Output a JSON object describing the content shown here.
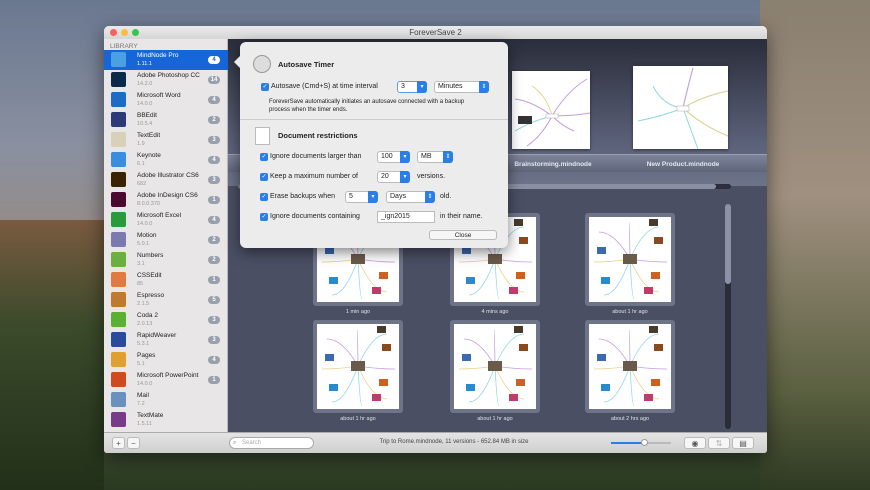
{
  "window": {
    "title": "ForeverSave 2"
  },
  "sidebar": {
    "header": "LIBRARY",
    "items": [
      {
        "name": "MindNode Pro",
        "version": "1.11.1",
        "count": "4",
        "selected": true,
        "icon": "mindnode-icon",
        "color": "#4aa0e0"
      },
      {
        "name": "Adobe Photoshop CC",
        "version": "14.2.0",
        "count": "14",
        "icon": "photoshop-icon",
        "color": "#0b2a4a"
      },
      {
        "name": "Microsoft Word",
        "version": "14.0.0",
        "count": "4",
        "icon": "word-icon",
        "color": "#1e6bc4"
      },
      {
        "name": "BBEdit",
        "version": "10.5.4",
        "count": "2",
        "icon": "bbedit-icon",
        "color": "#2c3a7a"
      },
      {
        "name": "TextEdit",
        "version": "1.9",
        "count": "3",
        "icon": "textedit-icon",
        "color": "#d8d0b8"
      },
      {
        "name": "Keynote",
        "version": "6.1",
        "count": "4",
        "icon": "keynote-icon",
        "color": "#3a8ee0"
      },
      {
        "name": "Adobe Illustrator CS6",
        "version": "682",
        "count": "3",
        "icon": "illustrator-icon",
        "color": "#3a2400"
      },
      {
        "name": "Adobe InDesign CS6",
        "version": "8.0.0.370",
        "count": "1",
        "icon": "indesign-icon",
        "color": "#4a0a30"
      },
      {
        "name": "Microsoft Excel",
        "version": "14.0.0",
        "count": "4",
        "icon": "excel-icon",
        "color": "#2a9a3a"
      },
      {
        "name": "Motion",
        "version": "5.0.1",
        "count": "2",
        "icon": "motion-icon",
        "color": "#7a7ab0"
      },
      {
        "name": "Numbers",
        "version": "3.1",
        "count": "2",
        "icon": "numbers-icon",
        "color": "#6ab040"
      },
      {
        "name": "CSSEdit",
        "version": "85",
        "count": "1",
        "icon": "cssedit-icon",
        "color": "#e07a40"
      },
      {
        "name": "Espresso",
        "version": "2.1.5",
        "count": "5",
        "icon": "espresso-icon",
        "color": "#c07a30"
      },
      {
        "name": "Coda 2",
        "version": "2.0.13",
        "count": "3",
        "icon": "coda-icon",
        "color": "#5ab030"
      },
      {
        "name": "RapidWeaver",
        "version": "5.3.1",
        "count": "3",
        "icon": "rapidweaver-icon",
        "color": "#2a4a9a"
      },
      {
        "name": "Pages",
        "version": "5.1",
        "count": "4",
        "icon": "pages-icon",
        "color": "#e0a030"
      },
      {
        "name": "Microsoft PowerPoint",
        "version": "14.0.0",
        "count": "1",
        "icon": "powerpoint-icon",
        "color": "#d04a20"
      },
      {
        "name": "Mail",
        "version": "7.2",
        "count": "",
        "icon": "mail-icon",
        "color": "#6a90c0"
      },
      {
        "name": "TextMate",
        "version": "1.5.11",
        "count": "",
        "icon": "textmate-icon",
        "color": "#7a3a8a"
      }
    ]
  },
  "shelf": {
    "documents": [
      {
        "name": "Brainstorming.mindnode"
      },
      {
        "name": "New Product.mindnode"
      }
    ],
    "progress": 0.97
  },
  "versions": [
    {
      "label": "1 min ago"
    },
    {
      "label": "4 mins ago"
    },
    {
      "label": "about 1 hr ago"
    },
    {
      "label": "about 1 hr ago"
    },
    {
      "label": "about 1 hr ago"
    },
    {
      "label": "about 2 hrs ago"
    }
  ],
  "popover": {
    "autosave_title": "Autosave Timer",
    "autosave_label": "Autosave (Cmd+S) at time interval",
    "autosave_value": "3",
    "autosave_unit": "Minutes",
    "autosave_desc_1": "ForeverSave automatically initiates an autosave connected with a backup",
    "autosave_desc_2": "process when the timer ends.",
    "restrictions_title": "Document restrictions",
    "ignore_larger_label": "Ignore documents larger than",
    "ignore_larger_value": "100",
    "ignore_larger_unit": "MB",
    "keep_max_label": "Keep a maximum number of",
    "keep_max_value": "20",
    "keep_max_suffix": "versions.",
    "erase_label": "Erase backups when",
    "erase_value": "5",
    "erase_unit": "Days",
    "erase_suffix": "old.",
    "ignore_containing_label": "Ignore documents containing",
    "ignore_containing_value": "_ign2015",
    "ignore_containing_suffix": "in their name.",
    "close_label": "Close"
  },
  "bottombar": {
    "add_label": "+",
    "remove_label": "−",
    "search_placeholder": "Search",
    "status": "Trip to Rome.mindnode, 11 versions - 652.84 MB in size",
    "zoom_level": 0.55
  },
  "colors": {
    "accent": "#1766d8",
    "checkbox": "#2a7ee8"
  }
}
